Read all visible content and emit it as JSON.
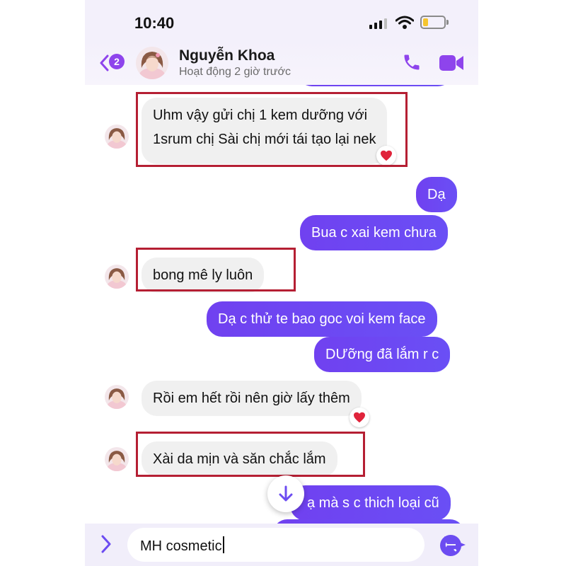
{
  "status_bar": {
    "time": "10:40",
    "battery_level": 0.2
  },
  "header": {
    "unread_count": "2",
    "contact_name": "Nguyễn Khoa",
    "contact_status": "Hoạt động 2 giờ trước"
  },
  "messages": [
    {
      "side": "in",
      "text_line1": "Uhm vậy gửi chị 1 kem dưỡng với",
      "text_line2": "1srum chị Sài chị mới tái tạo lại nek",
      "reaction": "heart",
      "highlighted": true
    },
    {
      "side": "out",
      "text": "Dạ"
    },
    {
      "side": "out",
      "text": "Bua c xai kem chưa"
    },
    {
      "side": "in",
      "text": "bong mê ly luôn",
      "highlighted": true
    },
    {
      "side": "out",
      "text": "Dạ c thử te bao goc voi kem face"
    },
    {
      "side": "out",
      "text": "DƯỡng đã lắm r c"
    },
    {
      "side": "in",
      "text": "Rồi em hết rồi nên giờ lấy thêm",
      "reaction": "heart"
    },
    {
      "side": "in",
      "text": "Xài da mịn và săn chắc lắm",
      "highlighted": true
    },
    {
      "side": "out",
      "text": "ạ mà s c thich loại cũ"
    }
  ],
  "composer": {
    "input_value": "MH cosmetic"
  },
  "colors": {
    "accent": "#7b4cf1",
    "outgoing_bubble": "#6a4ff5",
    "incoming_bubble": "#f0f0f0",
    "highlight_box": "#b51f33",
    "heart": "#e0243b"
  },
  "icons": {
    "back": "chevron-left-icon",
    "call": "phone-icon",
    "video": "video-camera-icon",
    "reaction": "heart-icon",
    "scroll": "arrow-down-icon",
    "expand": "chevron-right-icon",
    "search": "lens-icon",
    "send": "send-icon"
  }
}
